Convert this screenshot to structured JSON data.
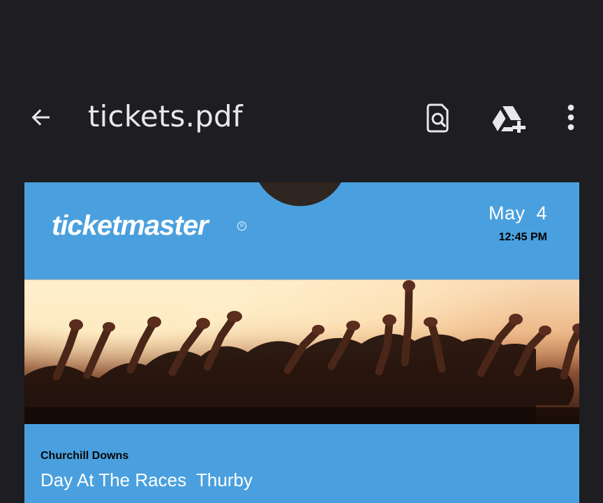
{
  "toolbar": {
    "title": "tickets.pdf",
    "back_icon": "arrow-back-icon",
    "search_icon": "search-document-icon",
    "drive_icon": "google-drive-add-icon",
    "more_icon": "more-vert-icon"
  },
  "ticket": {
    "brand": "ticketmaster",
    "registered_mark": "®",
    "date": "May  4",
    "time": "12:45 PM",
    "venue": "Churchill Downs",
    "event": "Day At The Races  Thurby"
  },
  "colors": {
    "app_background": "#1e1d22",
    "ticket_blue": "#4aa0de",
    "title_text": "#e8e8ea"
  }
}
